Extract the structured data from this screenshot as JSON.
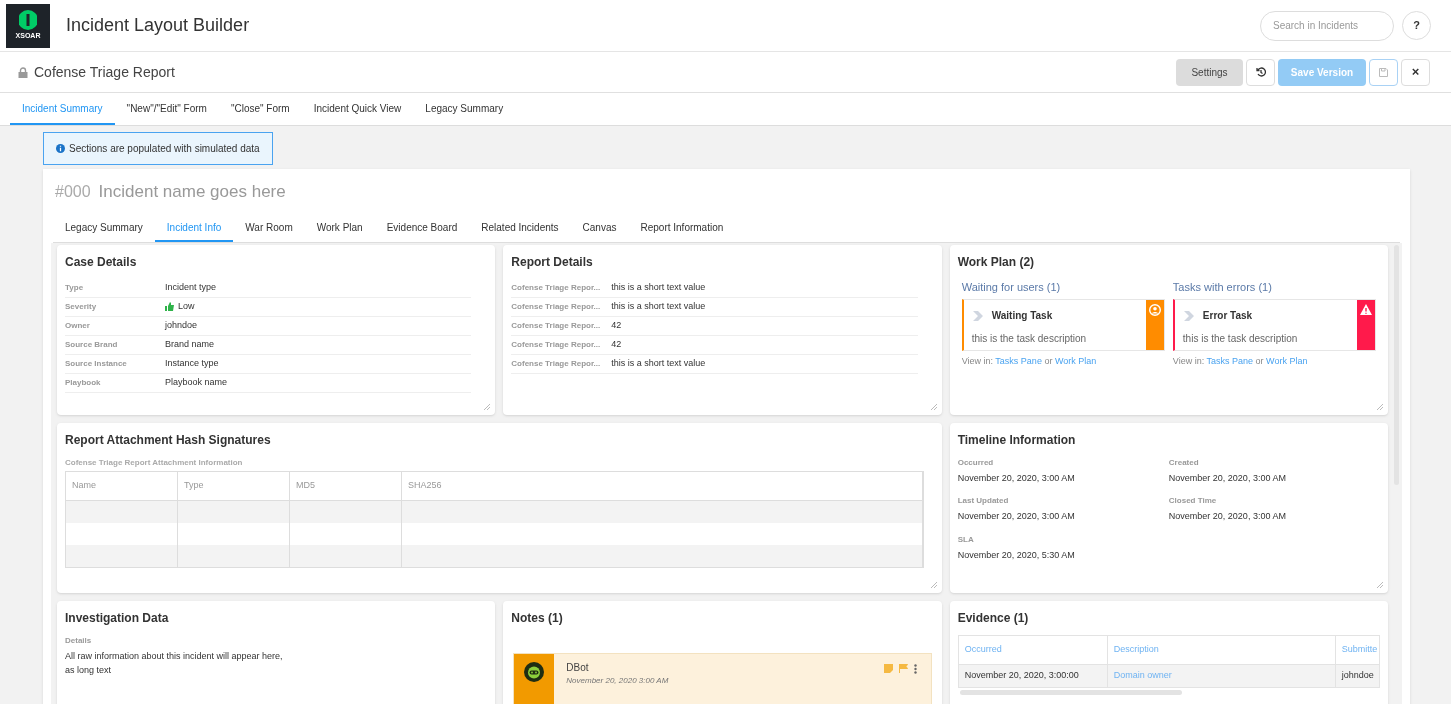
{
  "header": {
    "logo_text": "XSOAR",
    "title": "Incident Layout Builder",
    "search_placeholder": "Search in Incidents",
    "help": "?"
  },
  "toolbar": {
    "title": "Cofense Triage Report",
    "settings": "Settings",
    "save_version": "Save Version",
    "close": "×"
  },
  "main_tabs": [
    {
      "label": "Incident Summary",
      "selected": true
    },
    {
      "label": "\"New\"/\"Edit\" Form",
      "selected": false
    },
    {
      "label": "\"Close\" Form",
      "selected": false
    },
    {
      "label": "Incident Quick View",
      "selected": false
    },
    {
      "label": "Legacy Summary",
      "selected": false
    }
  ],
  "banner": "Sections are populated with simulated data",
  "incident": {
    "number": "#000",
    "name": "Incident name goes here"
  },
  "tabs": [
    {
      "label": "Legacy Summary",
      "selected": false
    },
    {
      "label": "Incident Info",
      "selected": true
    },
    {
      "label": "War Room",
      "selected": false
    },
    {
      "label": "Work Plan",
      "selected": false
    },
    {
      "label": "Evidence Board",
      "selected": false
    },
    {
      "label": "Related Incidents",
      "selected": false
    },
    {
      "label": "Canvas",
      "selected": false
    },
    {
      "label": "Report Information",
      "selected": false
    }
  ],
  "case_details": {
    "title": "Case Details",
    "rows": [
      {
        "label": "Type",
        "value": "Incident type",
        "kind": "text"
      },
      {
        "label": "Severity",
        "value": "Low",
        "kind": "severity"
      },
      {
        "label": "Owner",
        "value": "johndoe",
        "kind": "text"
      },
      {
        "label": "Source Brand",
        "value": "Brand name",
        "kind": "text"
      },
      {
        "label": "Source Instance",
        "value": "Instance type",
        "kind": "text"
      },
      {
        "label": "Playbook",
        "value": "Playbook name",
        "kind": "text"
      }
    ]
  },
  "report_details": {
    "title": "Report Details",
    "rows": [
      {
        "label": "Cofense Triage Repor...",
        "value": "this is a short text value"
      },
      {
        "label": "Cofense Triage Repor...",
        "value": "this is a short text value"
      },
      {
        "label": "Cofense Triage Repor...",
        "value": "42"
      },
      {
        "label": "Cofense Triage Repor...",
        "value": "42"
      },
      {
        "label": "Cofense Triage Repor...",
        "value": "this is a short text value"
      }
    ]
  },
  "work_plan": {
    "title": "Work Plan (2)",
    "groups": [
      {
        "heading": "Waiting for users (1)",
        "kind": "waiting",
        "task": "Waiting Task",
        "description": "this is the task description",
        "view_in": "View in:",
        "link_1": "Tasks Pane",
        "joiner": "or",
        "link_2": "Work Plan"
      },
      {
        "heading": "Tasks with errors (1)",
        "kind": "error",
        "task": "Error Task",
        "description": "this is the task description",
        "view_in": "View in:",
        "link_1": "Tasks Pane",
        "joiner": "or",
        "link_2": "Work Plan"
      }
    ]
  },
  "attachments": {
    "title": "Report Attachment Hash Signatures",
    "subtitle": "Cofense Triage Report Attachment Information",
    "columns": [
      "Name",
      "Type",
      "MD5",
      "SHA256"
    ]
  },
  "timeline": {
    "title": "Timeline Information",
    "items": [
      {
        "label": "Occurred",
        "value": "November 20, 2020, 3:00 AM"
      },
      {
        "label": "Created",
        "value": "November 20, 2020, 3:00 AM"
      },
      {
        "label": "Last Updated",
        "value": "November 20, 2020, 3:00 AM"
      },
      {
        "label": "Closed Time",
        "value": "November 20, 2020, 3:00 AM"
      },
      {
        "label": "SLA",
        "value": "November 20, 2020, 5:30 AM"
      }
    ]
  },
  "investigation": {
    "title": "Investigation Data",
    "label": "Details",
    "text": "All raw information about this incident will appear here,\nas long text"
  },
  "notes": {
    "title": "Notes (1)",
    "note": {
      "author": "DBot",
      "time": "November 20, 2020 3:00 AM"
    }
  },
  "evidence": {
    "title": "Evidence (1)",
    "columns": [
      "Occurred",
      "Description",
      "Submitte"
    ],
    "rows": [
      [
        "November 20, 2020, 3:00:00",
        "Domain owner",
        "johndoe"
      ]
    ]
  }
}
